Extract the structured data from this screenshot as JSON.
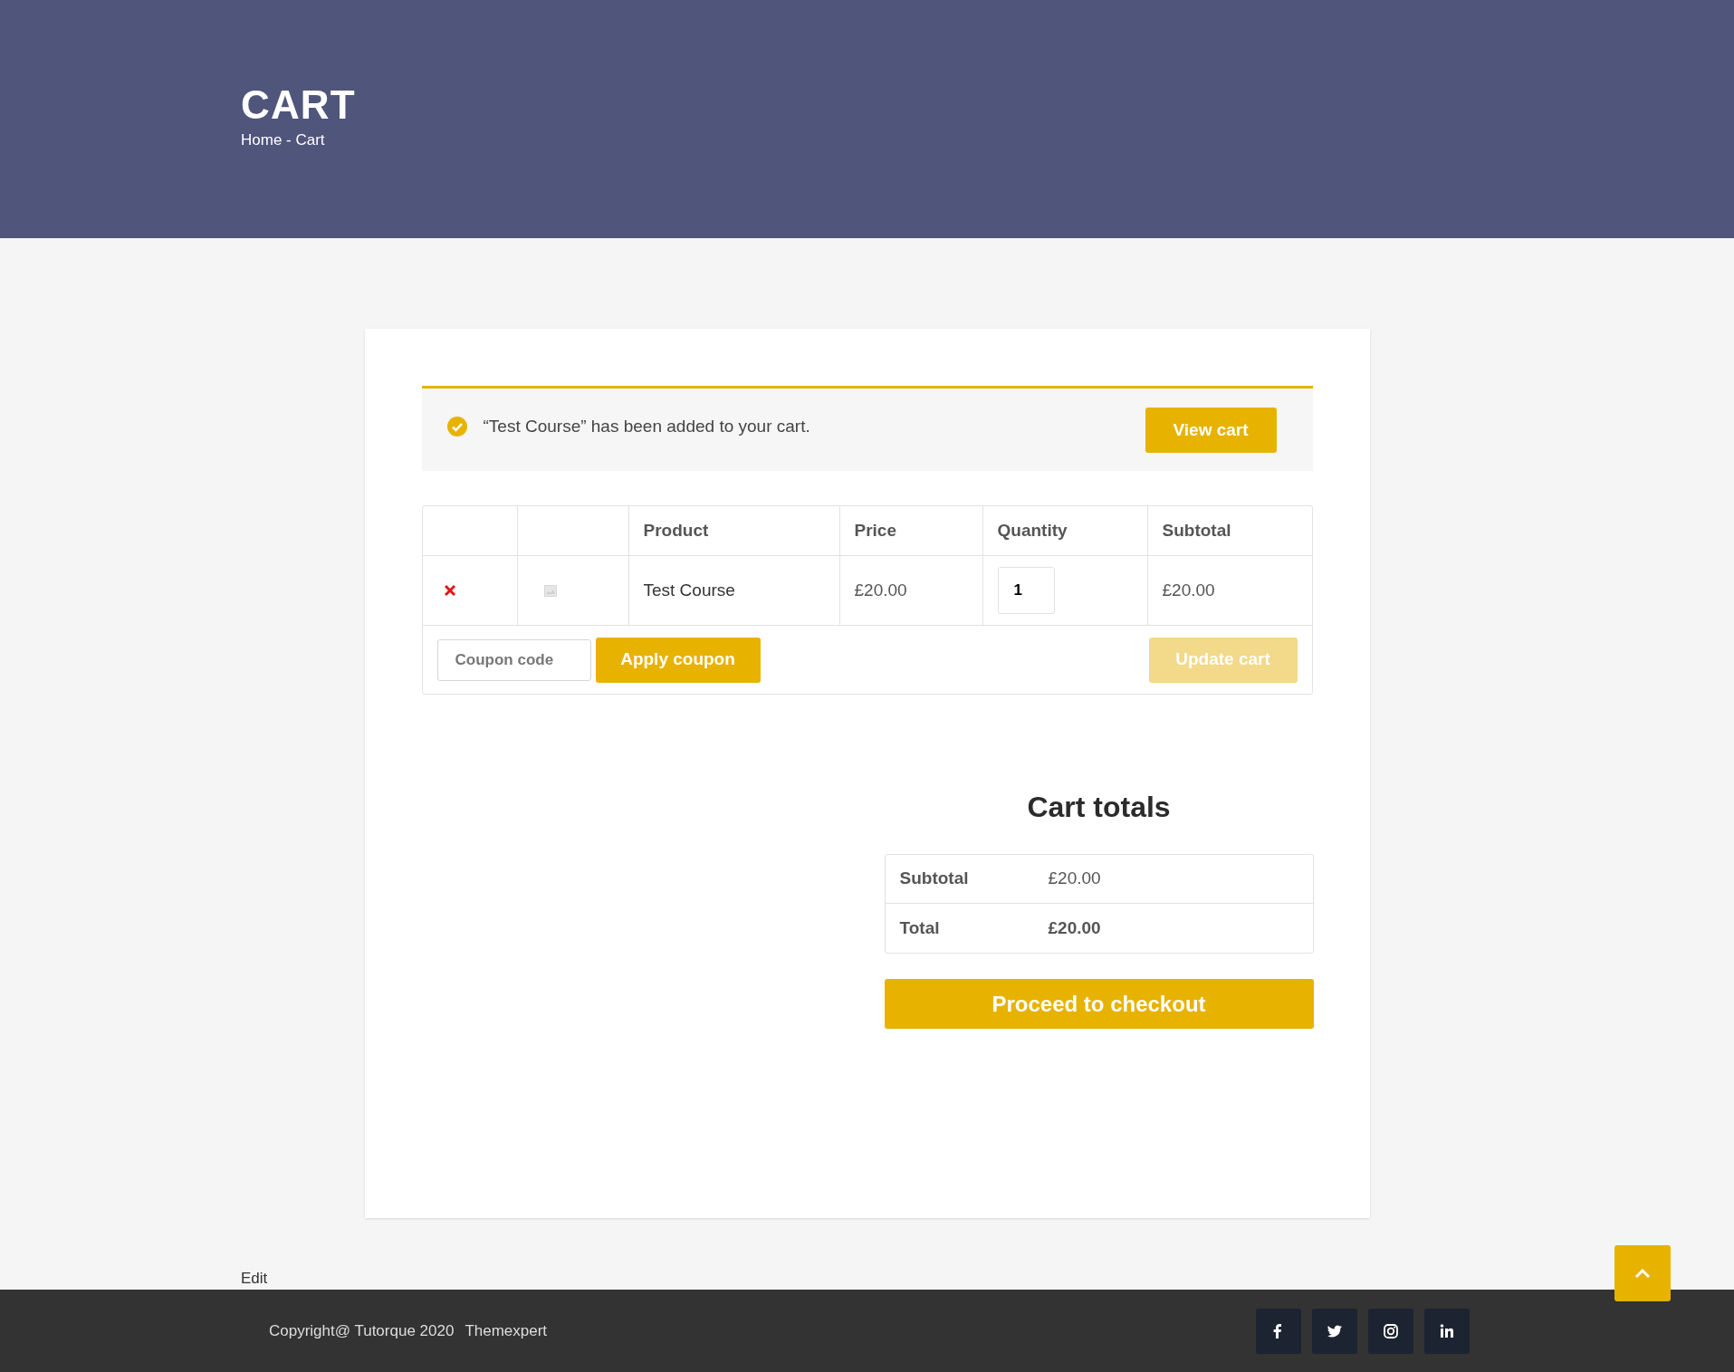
{
  "header": {
    "title": "CART",
    "breadcrumb": "Home - Cart"
  },
  "notice": {
    "message": "“Test Course” has been added to your cart.",
    "button": "View cart"
  },
  "cart_table": {
    "columns": [
      "Product",
      "Price",
      "Quantity",
      "Subtotal"
    ],
    "rows": [
      {
        "product": "Test Course",
        "price": "£20.00",
        "quantity": "1",
        "subtotal": "£20.00"
      }
    ],
    "coupon": {
      "placeholder": "Coupon code"
    },
    "apply_button": "Apply coupon",
    "update_button": {
      "label": "Update cart",
      "disabled": true
    }
  },
  "cart_totals": {
    "title": "Cart totals",
    "rows": [
      {
        "label": "Subtotal",
        "value": "£20.00",
        "bold": false
      },
      {
        "label": "Total",
        "value": "£20.00",
        "bold": true
      }
    ],
    "checkout_button": "Proceed to checkout"
  },
  "edit_link": "Edit",
  "footer": {
    "copyright": "Copyright@ Tutorque 2020",
    "brand": "Themexpert",
    "social": [
      {
        "kind": "facebook"
      },
      {
        "kind": "twitter"
      },
      {
        "kind": "instagram"
      },
      {
        "kind": "linkedin"
      }
    ]
  }
}
